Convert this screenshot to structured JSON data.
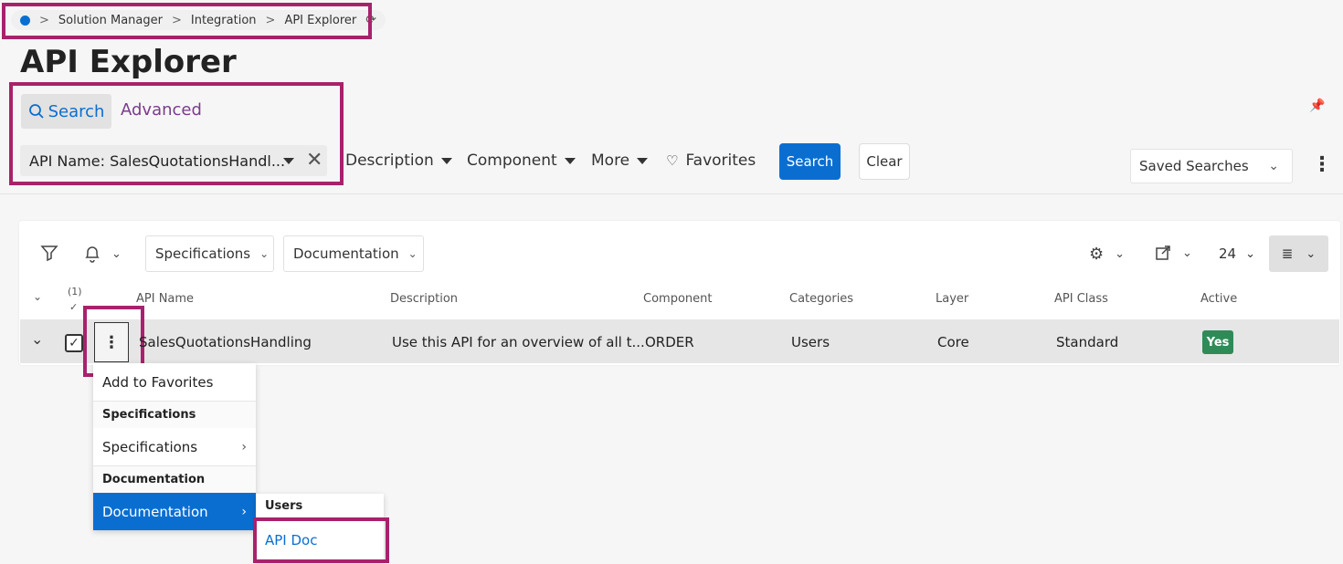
{
  "breadcrumb": {
    "items": [
      "Solution Manager",
      "Integration",
      "API Explorer"
    ],
    "separator": ">"
  },
  "page": {
    "title": "API Explorer"
  },
  "search_tabs": {
    "search": "Search",
    "advanced": "Advanced"
  },
  "filters": {
    "chip_label": "API Name: SalesQuotationsHandl...",
    "description": "Description",
    "component": "Component",
    "more": "More",
    "favorites": "Favorites",
    "search_button": "Search",
    "clear_button": "Clear",
    "saved_searches": "Saved Searches"
  },
  "toolbar": {
    "specifications": "Specifications",
    "documentation": "Documentation",
    "page_size": "24"
  },
  "table": {
    "selected_count": "(1)",
    "columns": [
      "API Name",
      "Description",
      "Component",
      "Categories",
      "Layer",
      "API Class",
      "Active"
    ],
    "row": {
      "api_name": "SalesQuotationsHandling",
      "description": "Use this API for an overview of all t...",
      "component": "ORDER",
      "categories": "Users",
      "layer": "Core",
      "api_class": "Standard",
      "active": "Yes"
    }
  },
  "context_menu": {
    "add_to_favorites": "Add to Favorites",
    "section_specifications": "Specifications",
    "specifications": "Specifications",
    "section_documentation": "Documentation",
    "documentation": "Documentation"
  },
  "submenu": {
    "header": "Users",
    "item": "API Doc"
  },
  "colors": {
    "accent": "#0a6ed1",
    "highlight": "#a8226b",
    "active_badge": "#2e8b57",
    "advanced_link": "#7a3b8c"
  }
}
